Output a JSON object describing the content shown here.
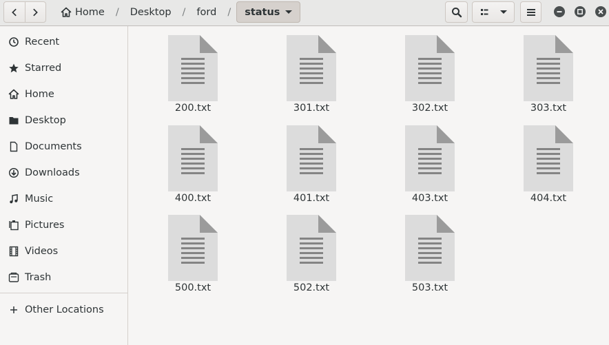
{
  "nav": {
    "back_icon": "go-previous-icon",
    "forward_icon": "go-next-icon"
  },
  "breadcrumbs": [
    "Home",
    "Desktop",
    "ford"
  ],
  "current_folder": "status",
  "separator": "/",
  "toolbar": {
    "search_icon": "search-icon",
    "view_icon": "view-list-icon",
    "menu_icon": "hamburger-menu-icon"
  },
  "window_controls": [
    "minimize",
    "maximize",
    "close"
  ],
  "sidebar": {
    "items": [
      {
        "label": "Recent",
        "icon": "clock-icon"
      },
      {
        "label": "Starred",
        "icon": "star-icon"
      },
      {
        "label": "Home",
        "icon": "home-icon"
      },
      {
        "label": "Desktop",
        "icon": "folder-icon"
      },
      {
        "label": "Documents",
        "icon": "document-icon"
      },
      {
        "label": "Downloads",
        "icon": "download-icon"
      },
      {
        "label": "Music",
        "icon": "music-icon"
      },
      {
        "label": "Pictures",
        "icon": "pictures-icon"
      },
      {
        "label": "Videos",
        "icon": "film-icon"
      },
      {
        "label": "Trash",
        "icon": "trash-icon"
      }
    ],
    "other_locations": {
      "label": "Other Locations",
      "icon": "plus-icon"
    }
  },
  "files": [
    "200.txt",
    "301.txt",
    "302.txt",
    "303.txt",
    "400.txt",
    "401.txt",
    "403.txt",
    "404.txt",
    "500.txt",
    "502.txt",
    "503.txt"
  ]
}
